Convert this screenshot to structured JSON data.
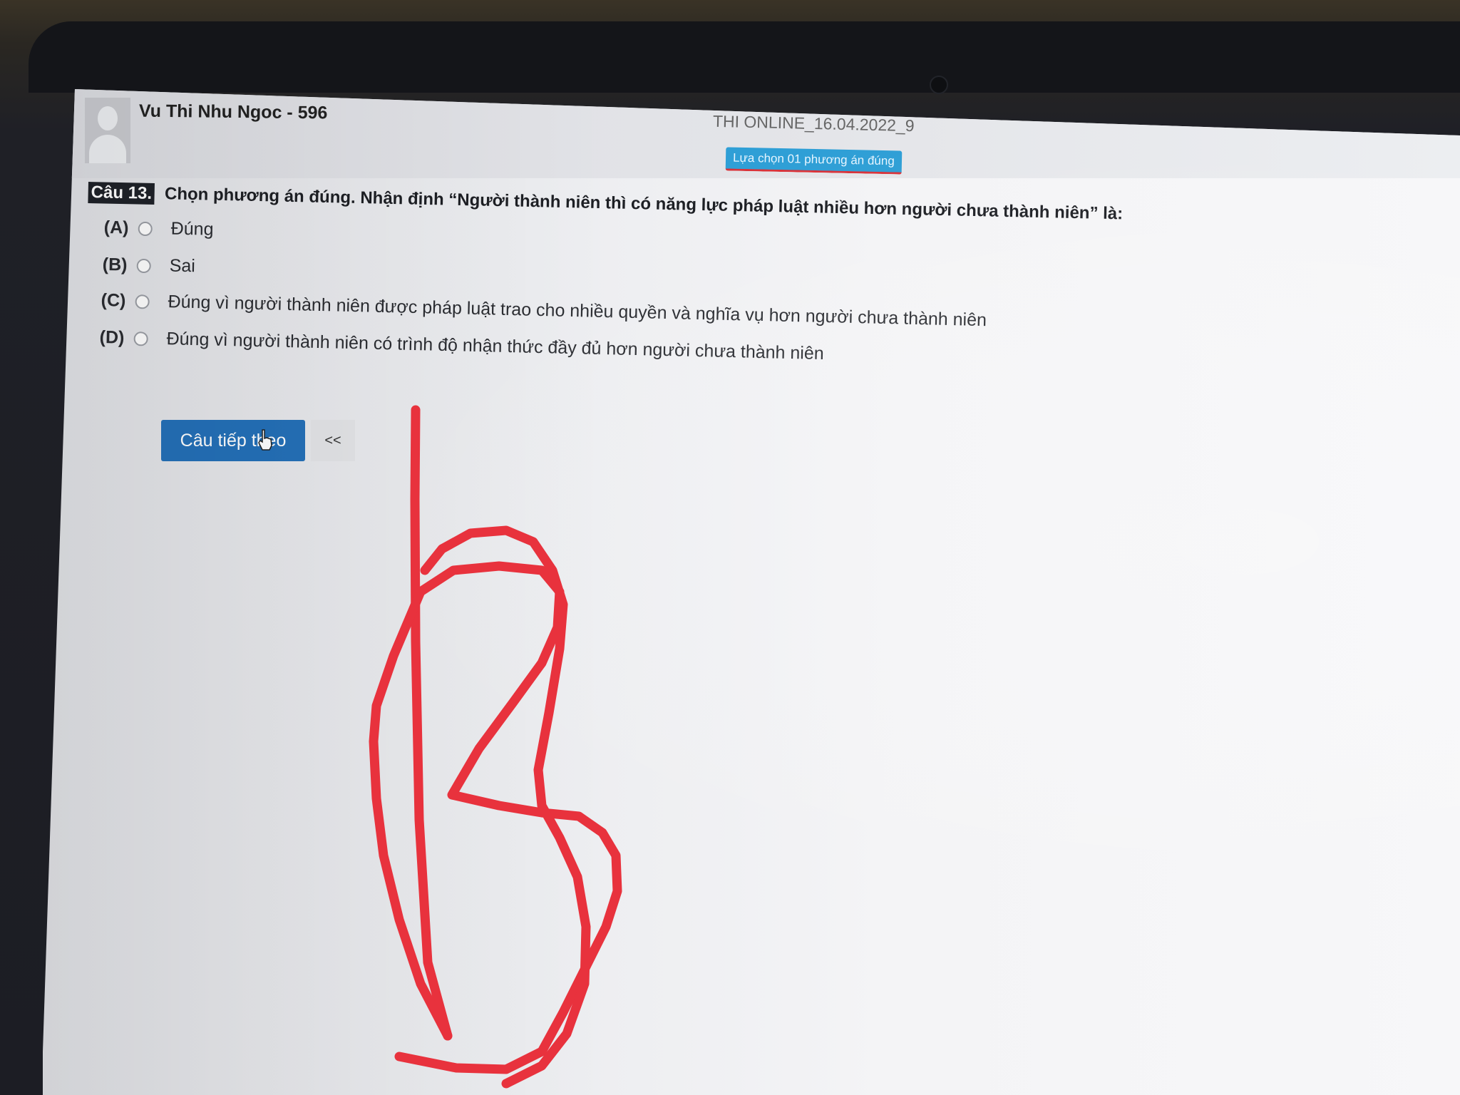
{
  "header": {
    "user_name": "Vu Thi Nhu Ngoc - 596",
    "exam_title": "THI ONLINE_16.04.2022_9",
    "instruction": "Lựa chọn 01 phương án đúng"
  },
  "question": {
    "number": "Câu 13.",
    "text": "Chọn phương án đúng. Nhận định “Người thành niên thì có năng lực pháp luật nhiều hơn người chưa thành niên” là:",
    "options": [
      {
        "letter": "(A)",
        "text": "Đúng"
      },
      {
        "letter": "(B)",
        "text": "Sai"
      },
      {
        "letter": "(C)",
        "text": "Đúng vì người thành niên được pháp luật trao cho nhiều quyền và nghĩa vụ hơn người chưa thành niên"
      },
      {
        "letter": "(D)",
        "text": "Đúng vì người thành niên có trình độ nhận thức đầy đủ hơn người chưa thành niên"
      }
    ]
  },
  "actions": {
    "next_label": "Câu tiếp theo",
    "prev_label": "<<"
  },
  "colors": {
    "primary_button": "#2470b8",
    "badge": "#2f9fd6",
    "annotation": "#e8323d"
  },
  "icons": {
    "avatar": "user-silhouette-icon",
    "cursor": "hand-pointer-icon"
  }
}
